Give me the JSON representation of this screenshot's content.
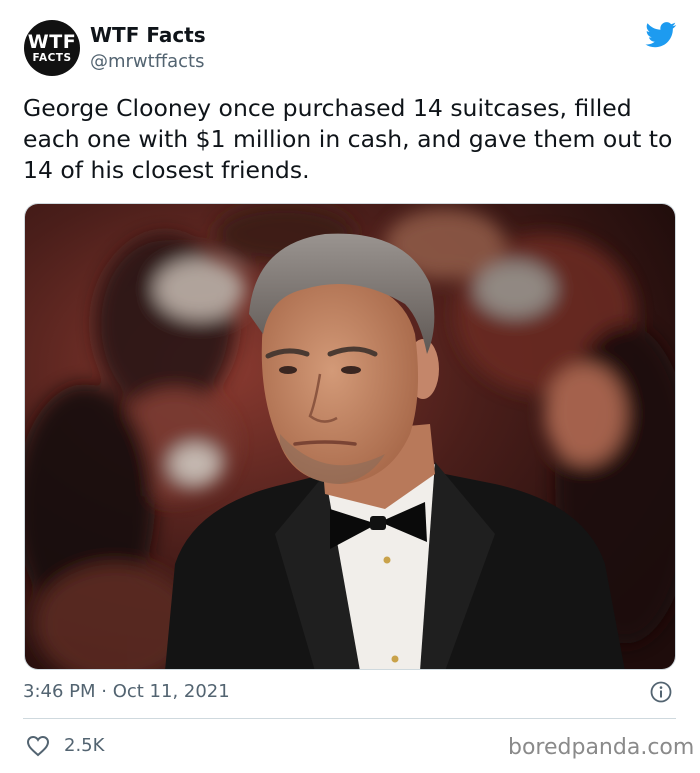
{
  "account": {
    "avatar_line1": "WTF",
    "avatar_line2": "FACTS",
    "name": "WTF Facts",
    "handle": "@mrwtffacts"
  },
  "tweet": {
    "text": "George Clooney once purchased 14 suitcases, filled each one with $1 million in cash, and gave them out to 14 of his closest friends.",
    "timestamp": "3:46 PM · Oct 11, 2021",
    "likes": "2.5K"
  },
  "icons": {
    "brand": "twitter-bird-icon",
    "info": "info-icon",
    "like": "heart-icon"
  },
  "source": "boredpanda.com",
  "colors": {
    "twitter_blue": "#1d9bf0",
    "secondary_text": "#536471",
    "divider": "#cfd9de"
  }
}
